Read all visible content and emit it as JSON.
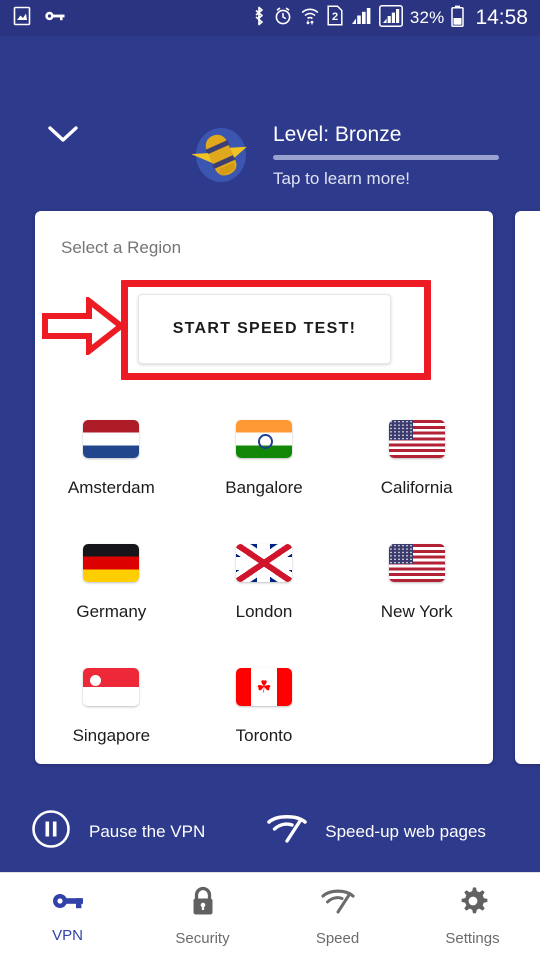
{
  "statusbar": {
    "battery_percent": "32%",
    "clock": "14:58",
    "sim_badge": "2",
    "icons": [
      "gallery-icon",
      "vpn-key-icon",
      "bluetooth-icon",
      "alarm-icon",
      "wifi-icon",
      "sim-2-icon",
      "signal-1-icon",
      "signal-2-icon",
      "battery-icon"
    ]
  },
  "header": {
    "level_title": "Level: Bronze",
    "level_subtitle": "Tap to learn more!",
    "progress_percent": 100,
    "collapse_icon": "chevron-down-icon",
    "mascot_icon": "mascot-icon"
  },
  "card": {
    "title": "Select a Region",
    "speed_test_label": "START SPEED TEST!",
    "regions": [
      {
        "name": "Amsterdam",
        "flag": "flag-netherlands"
      },
      {
        "name": "Bangalore",
        "flag": "flag-india"
      },
      {
        "name": "California",
        "flag": "flag-usa"
      },
      {
        "name": "Germany",
        "flag": "flag-germany"
      },
      {
        "name": "London",
        "flag": "flag-uk"
      },
      {
        "name": "New York",
        "flag": "flag-usa"
      },
      {
        "name": "Singapore",
        "flag": "flag-singapore"
      },
      {
        "name": "Toronto",
        "flag": "flag-canada"
      }
    ]
  },
  "annotation": {
    "highlight_color": "#ed1c24",
    "arrow_icon": "red-arrow-right-icon",
    "target": "START SPEED TEST!"
  },
  "actions": [
    {
      "label": "Pause the VPN",
      "icon": "pause-circle-icon"
    },
    {
      "label": "Speed-up web pages",
      "icon": "speed-icon"
    }
  ],
  "bottom_nav": {
    "active": "VPN",
    "items": [
      {
        "label": "VPN",
        "icon": "key-icon",
        "active": true
      },
      {
        "label": "Security",
        "icon": "lock-icon",
        "active": false
      },
      {
        "label": "Speed",
        "icon": "speed-icon",
        "active": false
      },
      {
        "label": "Settings",
        "icon": "gear-icon",
        "active": false
      }
    ]
  },
  "colors": {
    "brand_blue": "#2e3a8c",
    "statusbar_blue": "#2b3480",
    "accent_red": "#ed1c24",
    "nav_active": "#3342a8",
    "card_white": "#ffffff"
  }
}
